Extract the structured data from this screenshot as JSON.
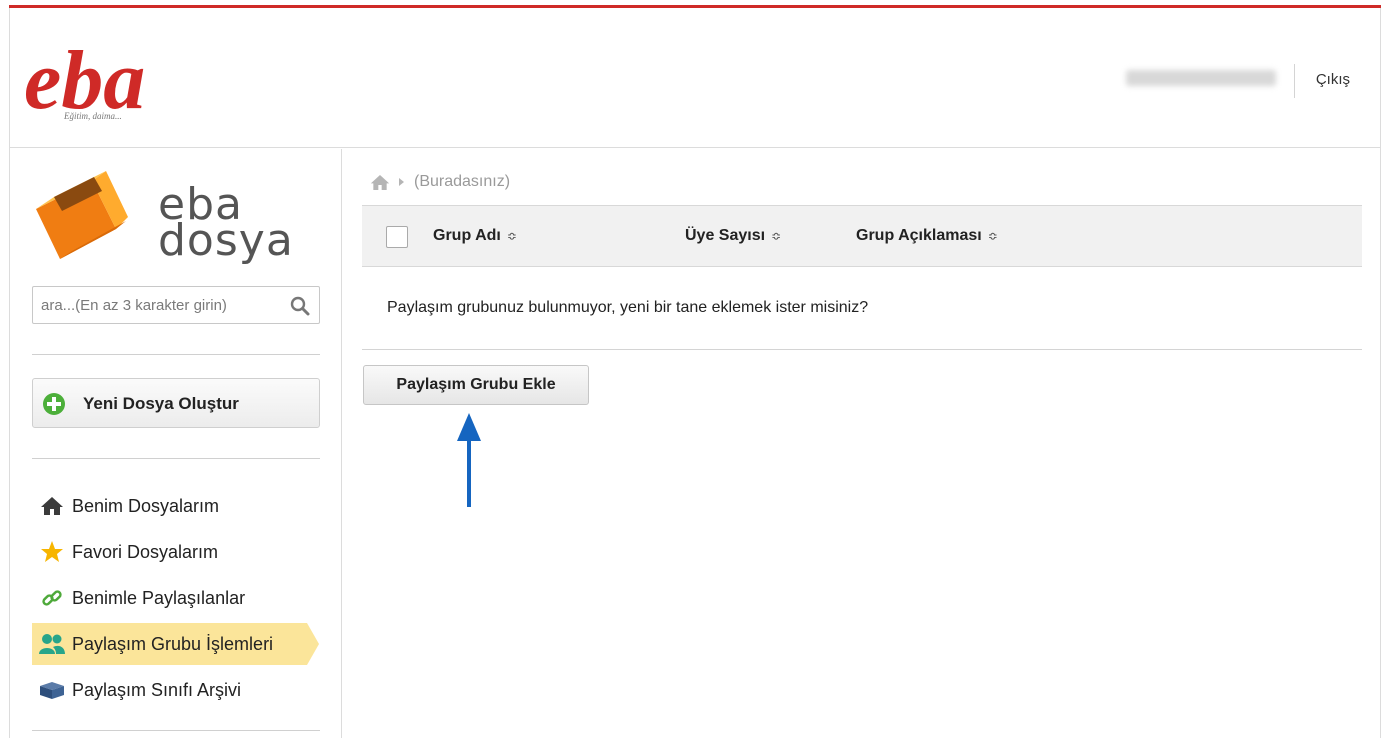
{
  "header": {
    "logo_text": "eba",
    "logo_tagline": "Eğitim, daima...",
    "user_name": "",
    "logout_label": "Çıkış"
  },
  "sidebar": {
    "brand_line1": "eba",
    "brand_line2": "dosya",
    "search_placeholder": "ara...(En az 3 karakter girin)",
    "new_file_label": "Yeni Dosya Oluştur",
    "items": [
      {
        "label": "Benim Dosyalarım",
        "icon": "home-icon",
        "active": false
      },
      {
        "label": "Favori Dosyalarım",
        "icon": "star-icon",
        "active": false
      },
      {
        "label": "Benimle Paylaşılanlar",
        "icon": "link-icon",
        "active": false
      },
      {
        "label": "Paylaşım Grubu İşlemleri",
        "icon": "users-icon",
        "active": true
      },
      {
        "label": "Paylaşım Sınıfı Arşivi",
        "icon": "archive-book-icon",
        "active": false
      }
    ]
  },
  "main": {
    "breadcrumb": "(Buradasınız)",
    "columns": [
      "Grup Adı",
      "Üye Sayısı",
      "Grup Açıklaması"
    ],
    "empty_message": "Paylaşım grubunuz bulunmuyor, yeni bir tane eklemek ister misiniz?",
    "add_button_label": "Paylaşım Grubu Ekle"
  },
  "colors": {
    "brand_red": "#cf2a27",
    "active_highlight": "#fbe59a",
    "arrow_blue": "#1565c0",
    "plus_green": "#4caf3a"
  }
}
